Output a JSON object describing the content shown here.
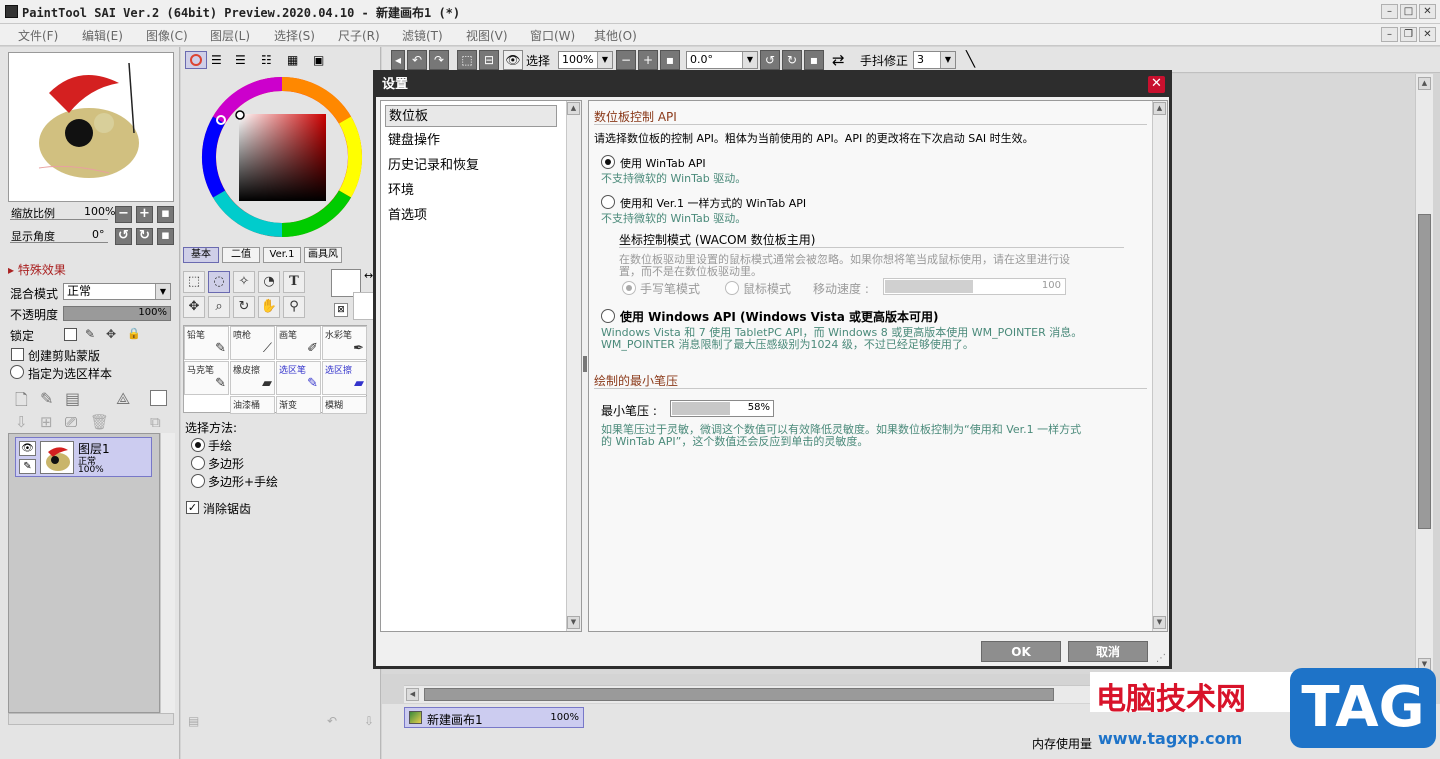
{
  "window": {
    "title": "PaintTool SAI Ver.2 (64bit) Preview.2020.04.10 - 新建画布1 (*)"
  },
  "menu": [
    "文件(F)",
    "编辑(E)",
    "图像(C)",
    "图层(L)",
    "选择(S)",
    "尺子(R)",
    "滤镜(T)",
    "视图(V)",
    "窗口(W)",
    "其他(O)"
  ],
  "navigator": {
    "zoom_label": "缩放比例",
    "zoom_value": "100%",
    "angle_label": "显示角度",
    "angle_value": "0°"
  },
  "layer_panel": {
    "section": "特殊效果",
    "blend_label": "混合模式",
    "blend_value": "正常",
    "opacity_label": "不透明度",
    "opacity_value": "100%",
    "lock_label": "锁定",
    "clip_label": "创建剪贴蒙版",
    "sel_source_label": "指定为选区样本",
    "layer": {
      "name": "图层1",
      "mode": "正常",
      "opacity": "100%"
    }
  },
  "tools": {
    "color_tabs": [
      "基本",
      "二值",
      "Ver.1",
      "画具风"
    ],
    "brushes": [
      "铅笔",
      "喷枪",
      "画笔",
      "水彩笔",
      "马克笔",
      "橡皮擦",
      "选区笔",
      "选区擦",
      "",
      "油漆桶",
      "渐变",
      "模糊"
    ],
    "selection_method_label": "选择方法:",
    "selection_options": [
      "手绘",
      "多边形",
      "多边形+手绘"
    ],
    "antialias_label": "消除锯齿"
  },
  "toolbar": {
    "select_label": "选择",
    "zoom": "100%",
    "angle": "0.0°",
    "stabilizer_label": "手抖修正",
    "stabilizer_value": "3"
  },
  "canvas_tab": {
    "name": "新建画布1",
    "zoom": "100%"
  },
  "status": {
    "memory_label": "内存使用量"
  },
  "dialog": {
    "title": "设置",
    "categories": [
      "数位板",
      "键盘操作",
      "历史记录和恢复",
      "环境",
      "首选项"
    ],
    "tablet_section": "数位板控制 API",
    "tablet_intro": "请选择数位板的控制 API。粗体为当前使用的 API。API 的更改将在下次启动 SAI 时生效。",
    "opt1": "使用 WinTab API",
    "opt1_hint": "不支持微软的 WinTab 驱动。",
    "opt2": "使用和 Ver.1 一样方式的 WinTab API",
    "opt2_hint": "不支持微软的 WinTab 驱动。",
    "coord_title": "坐标控制模式 (WACOM 数位板主用)",
    "coord_hint1": "在数位板驱动里设置的鼠标模式通常会被忽略。如果你想将笔当成鼠标使用，请在这里进行设",
    "coord_hint2": "置，而不是在数位板驱动里。",
    "pen_mode": "手写笔模式",
    "mouse_mode": "鼠标模式",
    "move_speed_label": "移动速度 :",
    "move_speed_value": "100",
    "opt3": "使用 Windows API (Windows Vista 或更高版本可用)",
    "opt3_hint1": "Windows Vista 和 7 使用 TabletPC API，而 Windows 8 或更高版本使用 WM_POINTER 消息。",
    "opt3_hint2": "WM_POINTER 消息限制了最大压感级别为1024 级，不过已经足够使用了。",
    "min_pressure_section": "绘制的最小笔压",
    "min_pressure_label": "最小笔压 :",
    "min_pressure_value": "58%",
    "min_pressure_hint1": "如果笔压过于灵敏，微调这个数值可以有效降低灵敏度。如果数位板控制为“使用和 Ver.1 一样方式",
    "min_pressure_hint2": "的 WinTab API”，这个数值还会反应到单击的灵敏度。",
    "ok": "OK",
    "cancel": "取消"
  },
  "watermark": {
    "site_name": "电脑技术网",
    "url": "www.tagxp.com",
    "tag": "TAG"
  }
}
